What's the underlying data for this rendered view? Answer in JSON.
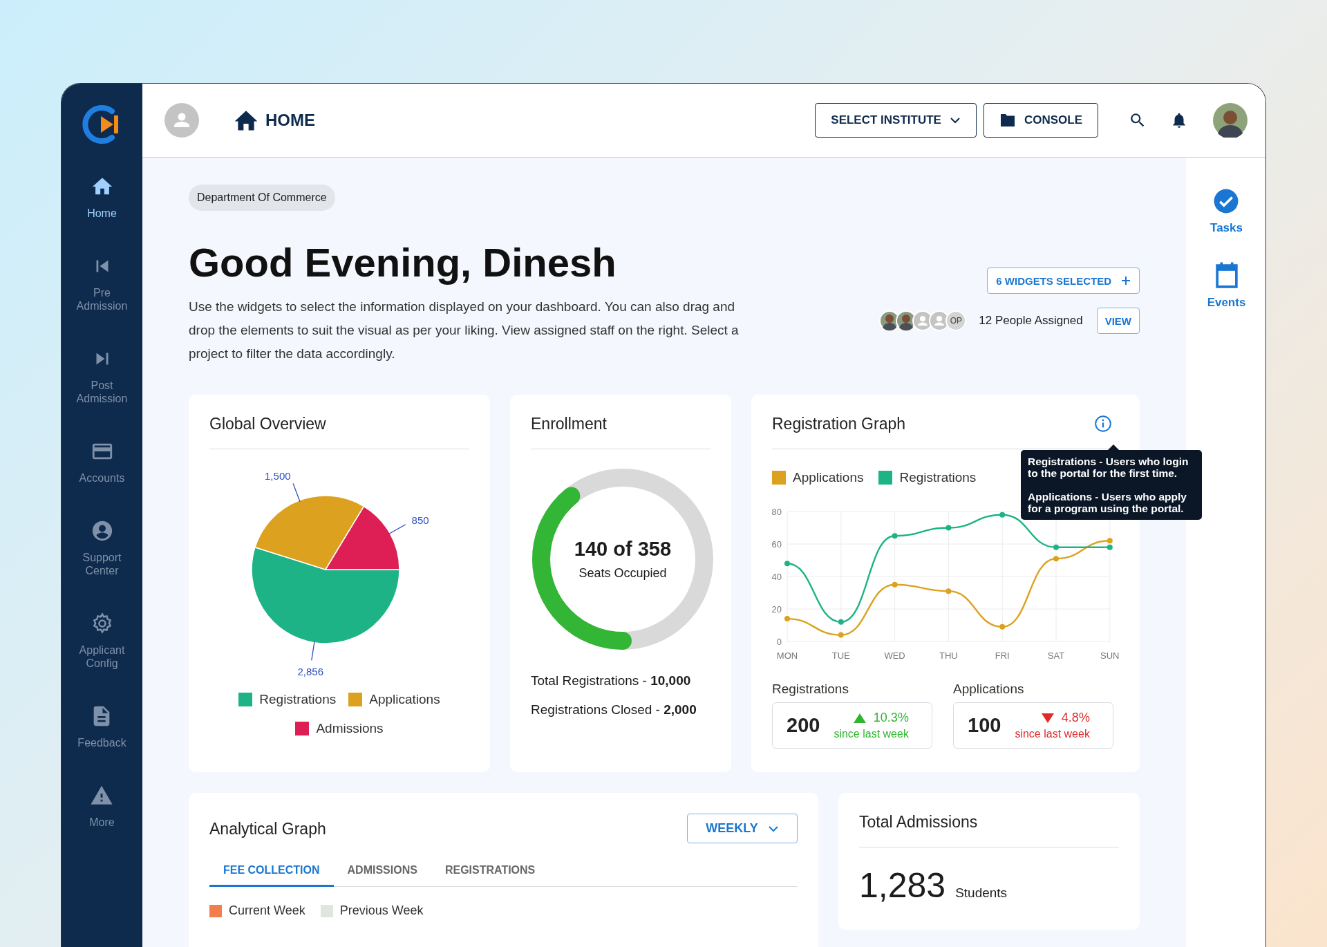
{
  "sidebar": {
    "items": [
      {
        "label": "Home",
        "selected": true
      },
      {
        "label": "Pre Admission",
        "selected": false
      },
      {
        "label": "Post Admission",
        "selected": false
      },
      {
        "label": "Accounts",
        "selected": false
      },
      {
        "label": "Support Center",
        "selected": false
      },
      {
        "label": "Applicant Config",
        "selected": false
      },
      {
        "label": "Feedback",
        "selected": false
      },
      {
        "label": "More",
        "selected": false
      }
    ]
  },
  "header": {
    "page_title": "HOME",
    "buttons": [
      {
        "label": "SELECT INSTITUTE",
        "kind": "dropdown"
      },
      {
        "label": "CONSOLE",
        "kind": "folder"
      }
    ]
  },
  "greeting": {
    "department": "Department Of Commerce",
    "title": "Good Evening, Dinesh",
    "description": "Use the widgets to select the information displayed on your dashboard. You can also drag and drop the elements to suit the visual as per your liking. View assigned staff on the right. Select a project to filter the data accordingly.",
    "widgets_button": "6 WIDGETS SELECTED",
    "people": {
      "avatars": [
        {
          "kind": "photo"
        },
        {
          "kind": "photo"
        },
        {
          "kind": "placeholder"
        },
        {
          "kind": "placeholder"
        },
        {
          "kind": "initials",
          "text": "OP"
        }
      ],
      "label": "12 People Assigned",
      "button": "VIEW"
    }
  },
  "right_rail": [
    {
      "label": "Tasks"
    },
    {
      "label": "Events"
    }
  ],
  "global_overview": {
    "title": "Global Overview",
    "chart_data": {
      "type": "pie",
      "categories": [
        "Registrations",
        "Applications",
        "Admissions"
      ],
      "values": [
        2856,
        1500,
        850
      ],
      "value_labels": [
        "2,856",
        "1,500",
        "850"
      ]
    },
    "legend": [
      {
        "color": "#1db386"
      },
      {
        "color": "#dca21f"
      },
      {
        "color": "#dd1f56"
      }
    ]
  },
  "enrollment": {
    "title": "Enrollment",
    "level": 0.391,
    "value": "140 of 358",
    "caption": "Seats Occupied",
    "facts": [
      "Total Registrations - **10,000**",
      "Registrations Closed - **2,000**"
    ]
  },
  "registration_graph": {
    "title": "Registration Graph",
    "tooltip": [
      "Registrations - Users who login to the portal for the first time.",
      "Applications - Users who apply for a program using the portal."
    ],
    "chart_data": {
      "type": "line",
      "categories": [
        "MON",
        "TUE",
        "WED",
        "THU",
        "FRI",
        "SAT",
        "SUN"
      ],
      "ylim": [
        0,
        80
      ],
      "yticks": [
        0,
        20,
        40,
        60,
        80
      ],
      "grid": true,
      "series": [
        {
          "name": "Applications",
          "color": "#dca21f",
          "marker": "circle",
          "values": [
            14,
            4,
            35,
            31,
            9,
            51,
            62
          ]
        },
        {
          "name": "Registrations",
          "color": "#1db386",
          "marker": "circle",
          "values": [
            48,
            12,
            65,
            70,
            78,
            58,
            58
          ]
        }
      ]
    },
    "stats": [
      {
        "label": "Registrations",
        "value": "200",
        "kind": "up",
        "change": "10.3%",
        "note": "since last week"
      },
      {
        "label": "Applications",
        "value": "100",
        "kind": "down",
        "change": "4.8%",
        "note": "since last week"
      }
    ]
  },
  "analytical_graph": {
    "title": "Analytical Graph",
    "period": "WEEKLY",
    "tabs": [
      {
        "label": "FEE COLLECTION",
        "selected": true
      },
      {
        "label": "ADMISSIONS",
        "selected": false
      },
      {
        "label": "REGISTRATIONS",
        "selected": false
      }
    ],
    "legend": [
      {
        "label": "Current Week",
        "color": "#f47d4d"
      },
      {
        "label": "Previous Week",
        "color": "#dde7dd"
      }
    ]
  },
  "total_admissions": {
    "title": "Total Admissions",
    "value": "1,283",
    "unit": "Students"
  }
}
